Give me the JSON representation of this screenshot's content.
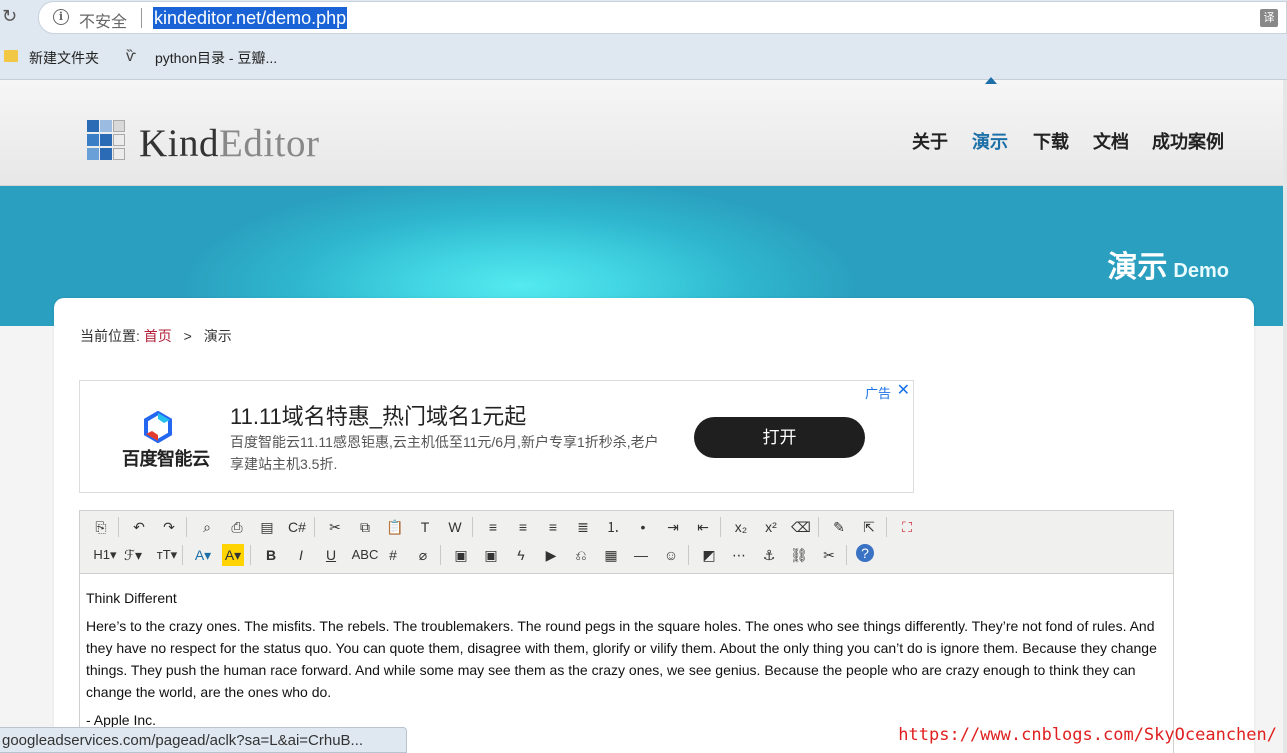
{
  "browser": {
    "insecure_label": "不安全",
    "url": "kindeditor.net/demo.php",
    "info_icon": "i",
    "translate_icon": "译",
    "bookmarks": [
      "新建文件夹",
      "python目录 - 豆瓣..."
    ]
  },
  "site": {
    "logo_kind": "Kind",
    "logo_editor": "Editor",
    "nav": [
      "关于",
      "演示",
      "下载",
      "文档",
      "成功案例"
    ],
    "active_nav": "演示",
    "banner_cn": "演示",
    "banner_en": "Demo"
  },
  "breadcrumb": {
    "label": "当前位置:",
    "home": "首页",
    "separator": ">",
    "current": "演示"
  },
  "ad": {
    "brand": "百度智能云",
    "title": "11.11域名特惠_热门域名1元起",
    "description": "百度智能云11.11感恩钜惠,云主机低至11元/6月,新户专享1折秒杀,老户享建站主机3.5折.",
    "button": "打开",
    "label": "广告",
    "close": "✕"
  },
  "editor": {
    "toolbar_row1": [
      {
        "name": "source-icon",
        "glyph": "⎘"
      },
      {
        "name": "undo-icon",
        "glyph": "↶"
      },
      {
        "name": "redo-icon",
        "glyph": "↷"
      },
      {
        "name": "preview-icon",
        "glyph": "⌕"
      },
      {
        "name": "print-icon",
        "glyph": "⎙"
      },
      {
        "name": "template-icon",
        "glyph": "▤"
      },
      {
        "name": "code-icon",
        "glyph": "C#"
      },
      {
        "name": "cut-icon",
        "glyph": "✂"
      },
      {
        "name": "copy-icon",
        "glyph": "⧉"
      },
      {
        "name": "paste-icon",
        "glyph": "📋"
      },
      {
        "name": "paste-text-icon",
        "glyph": "T"
      },
      {
        "name": "paste-word-icon",
        "glyph": "W"
      },
      {
        "name": "align-left-icon",
        "glyph": "≡"
      },
      {
        "name": "align-center-icon",
        "glyph": "≡"
      },
      {
        "name": "align-right-icon",
        "glyph": "≡"
      },
      {
        "name": "justify-icon",
        "glyph": "≣"
      },
      {
        "name": "ordered-list-icon",
        "glyph": "⒈"
      },
      {
        "name": "unordered-list-icon",
        "glyph": "•"
      },
      {
        "name": "indent-icon",
        "glyph": "⇥"
      },
      {
        "name": "outdent-icon",
        "glyph": "⇤"
      },
      {
        "name": "subscript-icon",
        "glyph": "x₂"
      },
      {
        "name": "superscript-icon",
        "glyph": "x²"
      },
      {
        "name": "clear-format-icon",
        "glyph": "⌫"
      },
      {
        "name": "quick-format-icon",
        "glyph": "✎"
      },
      {
        "name": "select-all-icon",
        "glyph": "⇱"
      },
      {
        "name": "fullscreen-icon",
        "glyph": "⛶"
      }
    ],
    "toolbar_row2": [
      {
        "name": "heading-icon",
        "glyph": "H1▾"
      },
      {
        "name": "font-family-icon",
        "glyph": "ℱ▾"
      },
      {
        "name": "font-size-icon",
        "glyph": "тT▾"
      },
      {
        "name": "font-color-icon",
        "glyph": "A▾"
      },
      {
        "name": "highlight-color-icon",
        "glyph": "A▾"
      },
      {
        "name": "bold-icon",
        "glyph": "B"
      },
      {
        "name": "italic-icon",
        "glyph": "I"
      },
      {
        "name": "underline-icon",
        "glyph": "U"
      },
      {
        "name": "strikethrough-icon",
        "glyph": "ABC"
      },
      {
        "name": "line-height-icon",
        "glyph": "#"
      },
      {
        "name": "remove-format-icon",
        "glyph": "⌀"
      },
      {
        "name": "image-icon",
        "glyph": "▣"
      },
      {
        "name": "multi-image-icon",
        "glyph": "▣"
      },
      {
        "name": "flash-icon",
        "glyph": "ϟ"
      },
      {
        "name": "media-icon",
        "glyph": "▶"
      },
      {
        "name": "attachment-icon",
        "glyph": "⎌"
      },
      {
        "name": "table-icon",
        "glyph": "▦"
      },
      {
        "name": "horizontal-rule-icon",
        "glyph": "—"
      },
      {
        "name": "emoticon-icon",
        "glyph": "☺"
      },
      {
        "name": "baidu-map-icon",
        "glyph": "◩"
      },
      {
        "name": "page-break-icon",
        "glyph": "⋯"
      },
      {
        "name": "anchor-icon",
        "glyph": "⚓"
      },
      {
        "name": "link-icon",
        "glyph": "⛓"
      },
      {
        "name": "unlink-icon",
        "glyph": "✂"
      },
      {
        "name": "help-icon",
        "glyph": "?"
      }
    ],
    "content": {
      "title": "Think Different",
      "body": "Here’s to the crazy ones. The misfits. The rebels. The troublemakers. The round pegs in the square holes. The ones who see things differently. They’re not fond of rules. And they have no respect for the status quo. You can quote them, disagree with them, glorify or vilify them. About the only thing you can’t do is ignore them. Because they change things. They push the human race forward. And while some may see them as the crazy ones, we see genius. Because the people who are crazy enough to think they can change the world, are the ones who do.",
      "signature": "- Apple Inc."
    }
  },
  "statusbar": {
    "url": "googleadservices.com/pagead/aclk?sa=L&ai=CrhuB..."
  },
  "watermark": "https://www.cnblogs.com/SkyOceanchen/",
  "colors": {
    "accent": "#1d6fa8",
    "home_link": "#b0203a",
    "banner": "#3fd1e0",
    "ad_button": "#1f1f1f",
    "watermark": "#e02020"
  }
}
